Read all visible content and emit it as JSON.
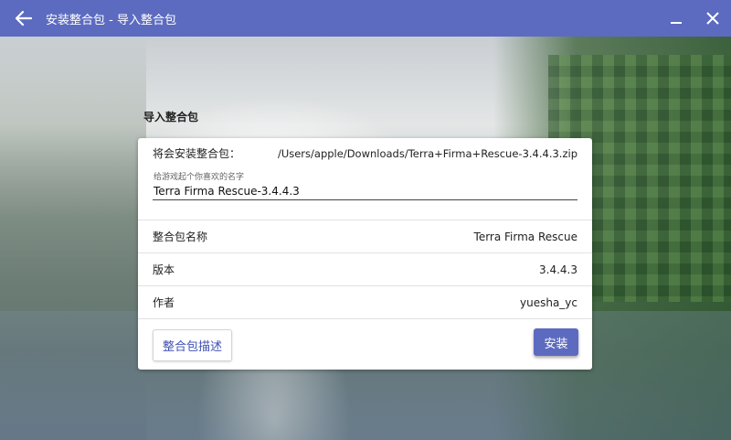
{
  "window": {
    "title": "安装整合包 - 导入整合包",
    "back_icon": "arrow-left-icon",
    "minimize_icon": "minimize-icon",
    "close_icon": "close-icon",
    "titlebar_color": "#5c6bc0"
  },
  "section": {
    "title": "导入整合包"
  },
  "card": {
    "file_label": "将会安装整合包：",
    "file_path": "/Users/apple/Downloads/Terra+Firma+Rescue-3.4.4.3.zip",
    "name_hint": "给游戏起个你喜欢的名字",
    "name_value": "Terra Firma Rescue-3.4.4.3",
    "pack_name_label": "整合包名称",
    "pack_name_value": "Terra Firma Rescue",
    "version_label": "版本",
    "version_value": "3.4.4.3",
    "author_label": "作者",
    "author_value": "yuesha_yc",
    "description_button": "整合包描述",
    "install_button": "安装"
  }
}
